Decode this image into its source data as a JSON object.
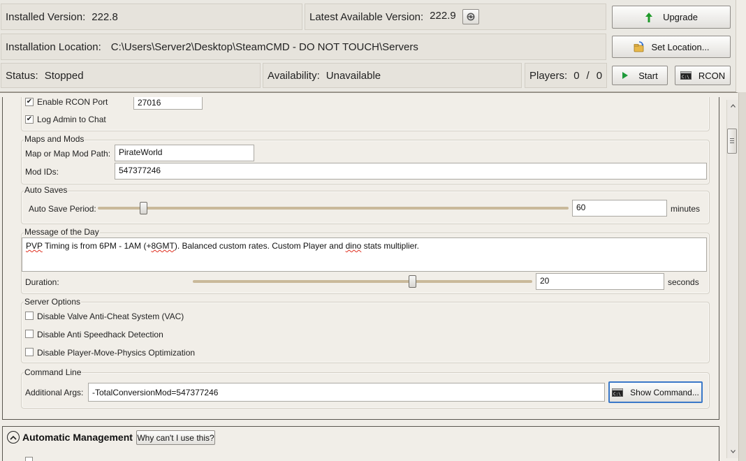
{
  "header": {
    "installed_version_label": "Installed Version:",
    "installed_version_value": "222.8",
    "latest_version_label": "Latest Available Version:",
    "latest_version_value": "222.9",
    "install_location_label": "Installation Location:",
    "install_location_value": "C:\\Users\\Server2\\Desktop\\SteamCMD - DO NOT TOUCH\\Servers",
    "status_label": "Status:",
    "status_value": "Stopped",
    "availability_label": "Availability:",
    "availability_value": "Unavailable",
    "players_label": "Players:",
    "players_current": "0",
    "players_sep": "/",
    "players_max": "0",
    "upgrade_label": "Upgrade",
    "set_location_label": "Set Location...",
    "start_label": "Start",
    "rcon_label": "RCON"
  },
  "rcon_section": {
    "enable_rcon_label": "Enable RCON Port",
    "enable_rcon_checked": true,
    "rcon_port_value": "27016",
    "log_admin_label": "Log Admin to Chat",
    "log_admin_checked": true
  },
  "maps_mods": {
    "title": "Maps and Mods",
    "map_path_label": "Map or Map Mod Path:",
    "map_path_value": "PirateWorld",
    "mod_ids_label": "Mod IDs:",
    "mod_ids_value": "547377246"
  },
  "auto_saves": {
    "title": "Auto Saves",
    "period_label": "Auto Save Period:",
    "period_value": "60",
    "period_unit": "minutes",
    "slider_fraction": 0.09
  },
  "motd": {
    "title": "Message of the Day",
    "message_part1": "PVP",
    "message_part2": " Timing is from 6PM - 1AM (+",
    "message_part3": "8GMT",
    "message_part4": "). Balanced custom rates. Custom Player and ",
    "message_part5": "dino",
    "message_part6": " stats multiplier.",
    "duration_label": "Duration:",
    "duration_value": "20",
    "duration_unit": "seconds",
    "slider_fraction": 0.65
  },
  "server_options": {
    "title": "Server Options",
    "options": [
      {
        "label": "Disable Valve Anti-Cheat System (VAC)",
        "checked": false
      },
      {
        "label": "Disable Anti Speedhack Detection",
        "checked": false
      },
      {
        "label": "Disable Player-Move-Physics Optimization",
        "checked": false
      }
    ]
  },
  "command_line": {
    "title": "Command Line",
    "args_label": "Additional Args:",
    "args_value": "-TotalConversionMod=547377246",
    "show_command_label": "Show Command..."
  },
  "automatic_management": {
    "title": "Automatic Management",
    "why_button_label": "Why can't I use this?"
  },
  "icons": [
    "refresh-icon",
    "upgrade-arrow-icon",
    "set-location-icon",
    "play-icon",
    "console-icon",
    "collapse-chevron-icon"
  ],
  "colors": {
    "slider_track": "#c9b99a",
    "upgrade_arrow": "#1f9a2a",
    "play": "#1e9a3a"
  }
}
